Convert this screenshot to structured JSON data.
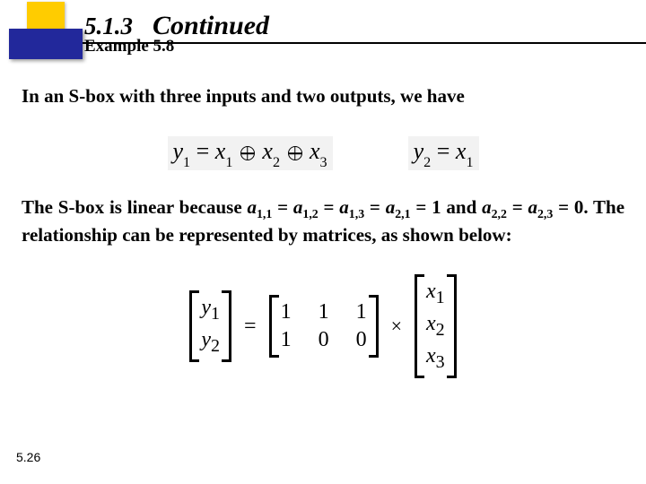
{
  "header": {
    "section_number": "5.1.3",
    "continued": "Continued",
    "example_label": "Example 5.8"
  },
  "para1": "In an S-box with three inputs and two outputs, we have",
  "equations": {
    "y1": "y",
    "y1sub": "1",
    "y2": "y",
    "y2sub": "2",
    "x1": "x",
    "x1sub": "1",
    "x2": "x",
    "x2sub": "2",
    "x3": "x",
    "x3sub": "3",
    "eq": "="
  },
  "para2_parts": {
    "t1": "The S-box is linear because ",
    "a11": "a",
    "a11s": "1,1",
    "t2": " = ",
    "a12": "a",
    "a12s": "1,2",
    "a13": "a",
    "a13s": "1,3",
    "a21": "a",
    "a21s": "2,1",
    "t3": " = 1 and ",
    "a22": "a",
    "a22s": "2,2",
    "a23": "a",
    "a23s": "2,3",
    "t4": " = 0. The relationship can be represented by matrices, as shown below:"
  },
  "matrix": {
    "y1": "y",
    "y1s": "1",
    "y2": "y",
    "y2s": "2",
    "eq": "=",
    "times": "×",
    "r1c1": "1",
    "r1c2": "1",
    "r1c3": "1",
    "r2c1": "1",
    "r2c2": "0",
    "r2c3": "0",
    "x1": "x",
    "x1s": "1",
    "x2": "x",
    "x2s": "2",
    "x3": "x",
    "x3s": "3"
  },
  "page_number": "5.26"
}
